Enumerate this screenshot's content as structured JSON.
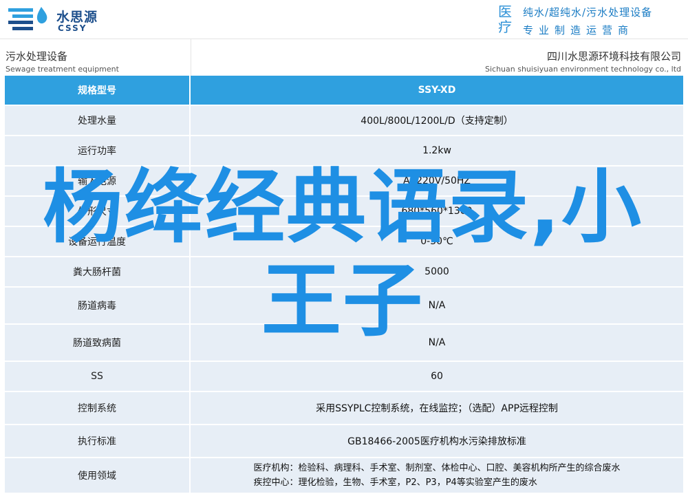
{
  "header": {
    "logo_cn": "水思源",
    "logo_en": "CSSY",
    "slogan_big": "医疗",
    "slogan_line1": "纯水/超纯水/污水处理设备",
    "slogan_line2": "专业制造运营商"
  },
  "titlebar": {
    "left_cn": "污水处理设备",
    "left_en": "Sewage treatment equipment",
    "right_cn": "四川水思源环境科技有限公司",
    "right_en": "Sichuan shuisiyuan environment technology co., ltd"
  },
  "table": {
    "head": {
      "key": "规格型号",
      "value": "SSY-XD"
    },
    "rows": [
      {
        "key": "处理水量",
        "value": "400L/800L/1200L/D（支持定制）"
      },
      {
        "key": "运行功率",
        "value": "1.2kw"
      },
      {
        "key": "输入电源",
        "value": "AC220V/50HZ"
      },
      {
        "key": "外形尺寸",
        "value": "680*560*1300"
      },
      {
        "key": "设备运行温度",
        "value": "0-50℃"
      },
      {
        "key": "粪大肠杆菌",
        "value": "5000"
      },
      {
        "key": "肠道病毒",
        "value": "N/A"
      },
      {
        "key": "肠道致病菌",
        "value": "N/A"
      },
      {
        "key": "SS",
        "value": "60"
      },
      {
        "key": "控制系统",
        "value": "采用SSYPLC控制系统，在线监控；（选配）APP远程控制"
      },
      {
        "key": "执行标准",
        "value": "GB18466-2005医疗机构水污染排放标准"
      },
      {
        "key": "使用领域",
        "value_line1": "医疗机构：检验科、病理科、手术室、制剂室、体检中心、口腔、美容机构所产生的综合废水",
        "value_line2": "疾控中心：理化检验，生物、手术室，P2、P3，P4等实验室产生的废水"
      }
    ]
  },
  "overlay": {
    "line1": "杨绛经典语录,小",
    "line2": "王子"
  },
  "colors": {
    "accent": "#2fa0df",
    "row_bg": "#e7eef6",
    "overlay_text": "#1e8fe4",
    "logo_blue": "#1d4f8c"
  }
}
